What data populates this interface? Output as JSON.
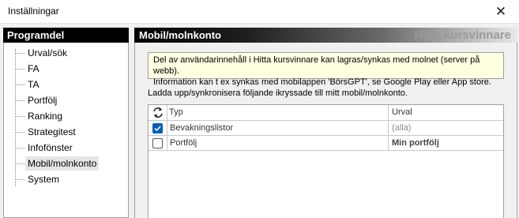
{
  "window": {
    "title": "Inställningar"
  },
  "left_panel": {
    "header": "Programdel",
    "items": [
      {
        "label": "Urval/sök"
      },
      {
        "label": "FA"
      },
      {
        "label": "TA"
      },
      {
        "label": "Portfölj"
      },
      {
        "label": "Ranking"
      },
      {
        "label": "Strategitest"
      },
      {
        "label": "Infofönster"
      },
      {
        "label": "Mobil/molnkonto",
        "selected": true
      },
      {
        "label": "System"
      }
    ]
  },
  "right_panel": {
    "title": "Mobil/molnkonto",
    "brand": "Hitta kursvinnare",
    "info_line1": "Del av användarinnehåll i Hitta kursvinnare kan lagras/synkas med molnet (server på webb).",
    "info_line2": "Information kan t ex synkas med mobilappen 'BörsGPT', se Google Play eller App store.",
    "instruction": "Ladda upp/synkronisera följande ikryssade till mitt mobil/molnkonto.",
    "table": {
      "col_type": "Typ",
      "col_selection": "Urval",
      "rows": [
        {
          "type": "Bevakningslistor",
          "selection": "(alla)",
          "checked": true
        },
        {
          "type": "Portfölj",
          "selection": "Min portfölj",
          "checked": false
        }
      ]
    }
  },
  "colors": {
    "checkbox_checked": "#005fb8",
    "info_background": "#ffffe1",
    "brand_text": "#9a9a9a"
  },
  "icons": [
    "close-icon",
    "sync-icon",
    "checkbox-checked",
    "checkbox-unchecked"
  ]
}
